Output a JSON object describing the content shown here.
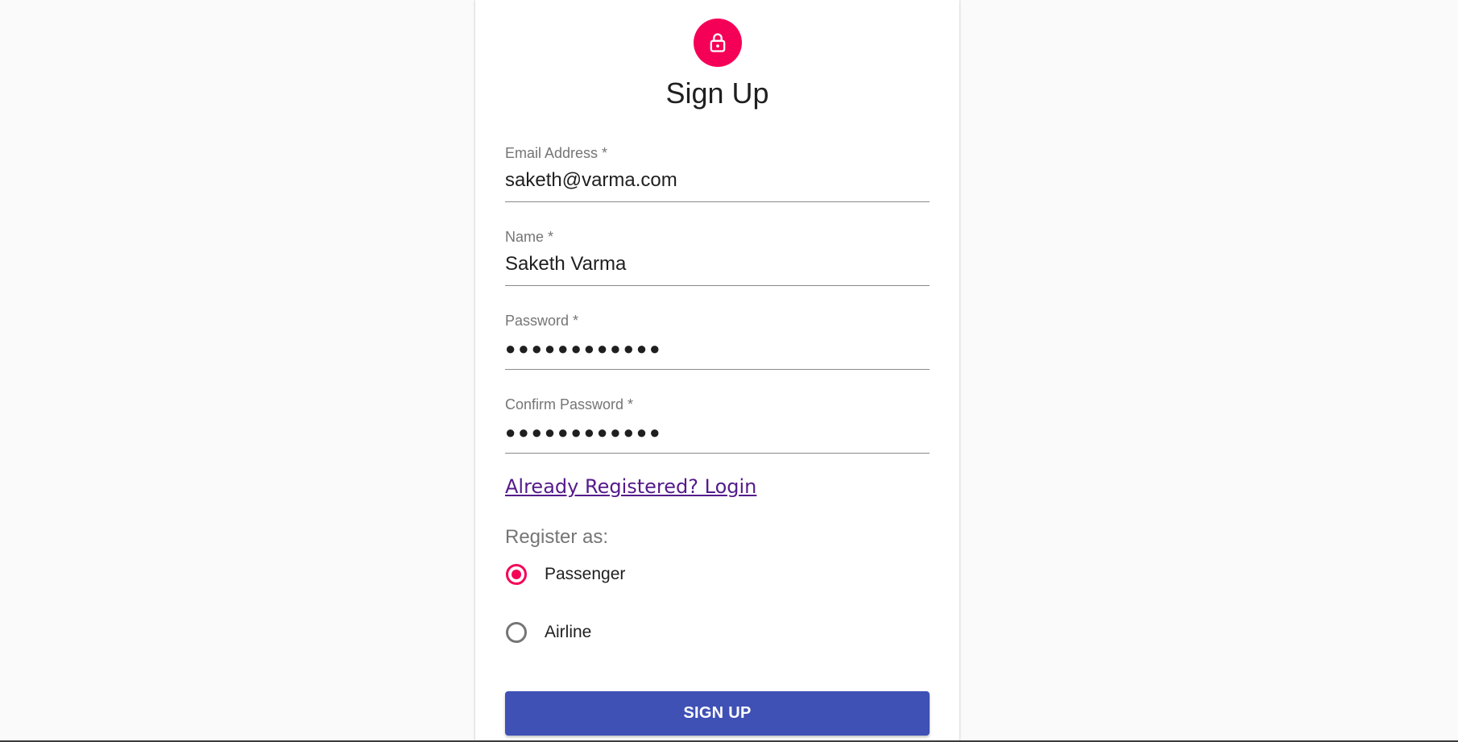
{
  "form": {
    "title": "Sign Up",
    "email": {
      "label": "Email Address *",
      "value": "saketh@varma.com"
    },
    "name": {
      "label": "Name *",
      "value": "Saketh Varma"
    },
    "password": {
      "label": "Password *",
      "value": "●●●●●●●●●●●●"
    },
    "confirm_password": {
      "label": "Confirm Password *",
      "value": "●●●●●●●●●●●●"
    },
    "login_link": "Already Registered? Login",
    "register_as_label": "Register as:",
    "options": [
      {
        "label": "Passenger",
        "selected": true
      },
      {
        "label": "Airline",
        "selected": false
      }
    ],
    "submit_label": "SIGN UP"
  },
  "colors": {
    "accent": "#f50057",
    "primary": "#3f51b5",
    "link": "#551a8b"
  },
  "icons": {
    "avatar": "lock-icon"
  }
}
